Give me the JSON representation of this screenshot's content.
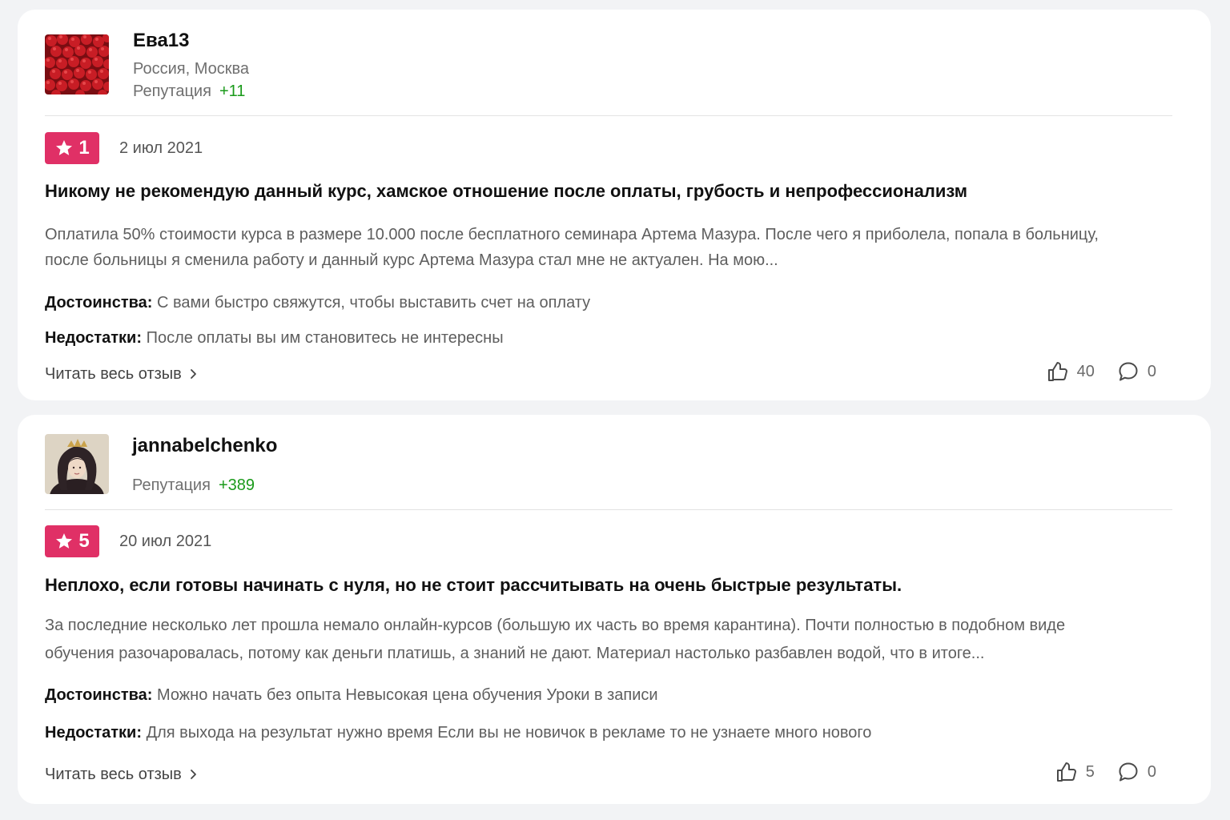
{
  "reviews": [
    {
      "author": {
        "name": "Ева13",
        "location": "Россия, Москва",
        "reputation_label": "Репутация",
        "reputation_value": "+11"
      },
      "rating": "1",
      "date": "2 июл 2021",
      "title": "Никому не рекомендую данный курс, хамское отношение после оплаты, грубость и непрофессионализм",
      "text": "Оплатила 50% стоимости курса в размере 10.000 после бесплатного семинара Артема Мазура. После чего я приболела, попала в больницу, после больницы я сменила работу и данный курс Артема Мазура стал мне не актуален. На мою...",
      "pros_label": "Достоинства:",
      "pros": "С вами быстро свяжутся, чтобы выставить счет на оплату",
      "cons_label": "Недостатки:",
      "cons": "После оплаты вы им становитесь не интересны",
      "read_more": "Читать весь отзыв",
      "likes": "40",
      "comments": "0"
    },
    {
      "author": {
        "name": "jannabelchenko",
        "location": "",
        "reputation_label": "Репутация",
        "reputation_value": "+389"
      },
      "rating": "5",
      "date": "20 июл 2021",
      "title": "Неплохо, если готовы начинать с нуля, но не стоит рассчитывать на очень быстрые результаты.",
      "text": "За последние несколько лет прошла немало онлайн-курсов (большую их часть во время карантина). Почти полностью в подобном виде обучения разочаровалась, потому как деньги платишь, а знаний не дают. Материал настолько разбавлен водой, что в итоге...",
      "pros_label": "Достоинства:",
      "pros": "Можно начать без опыта Невысокая цена обучения Уроки в записи",
      "cons_label": "Недостатки:",
      "cons": "Для выхода на результат нужно время Если вы не новичок в рекламе то не узнаете много нового",
      "read_more": "Читать весь отзыв",
      "likes": "5",
      "comments": "0"
    }
  ],
  "colors": {
    "rating_badge": "#e03066",
    "reputation_positive": "#1a9a1a",
    "card_background": "#ffffff",
    "page_background": "#f2f3f5"
  },
  "icons": {
    "rating": "star-icon",
    "read_more": "chevron-right-icon",
    "like": "thumbs-up-icon",
    "comment": "speech-bubble-icon"
  }
}
